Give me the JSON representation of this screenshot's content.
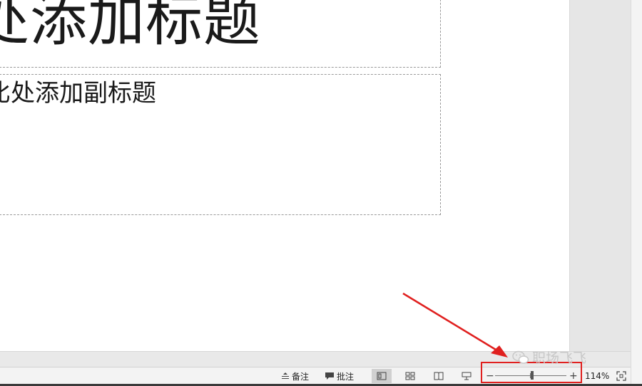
{
  "slide": {
    "title_placeholder": "处添加标题",
    "subtitle_placeholder": "比处添加副标题"
  },
  "status_bar": {
    "notes_label": "备注",
    "comments_label": "批注",
    "views": [
      {
        "icon": "normal-view-icon",
        "active": true
      },
      {
        "icon": "slide-sorter-icon",
        "active": false
      },
      {
        "icon": "reading-view-icon",
        "active": false
      },
      {
        "icon": "slideshow-icon",
        "active": false
      }
    ],
    "zoom": {
      "minus": "−",
      "plus": "+",
      "percent_label": "114%",
      "value_percent": 114
    }
  },
  "watermark": {
    "text": "职场飞飞"
  },
  "annotation": {
    "color": "#e0201f"
  }
}
